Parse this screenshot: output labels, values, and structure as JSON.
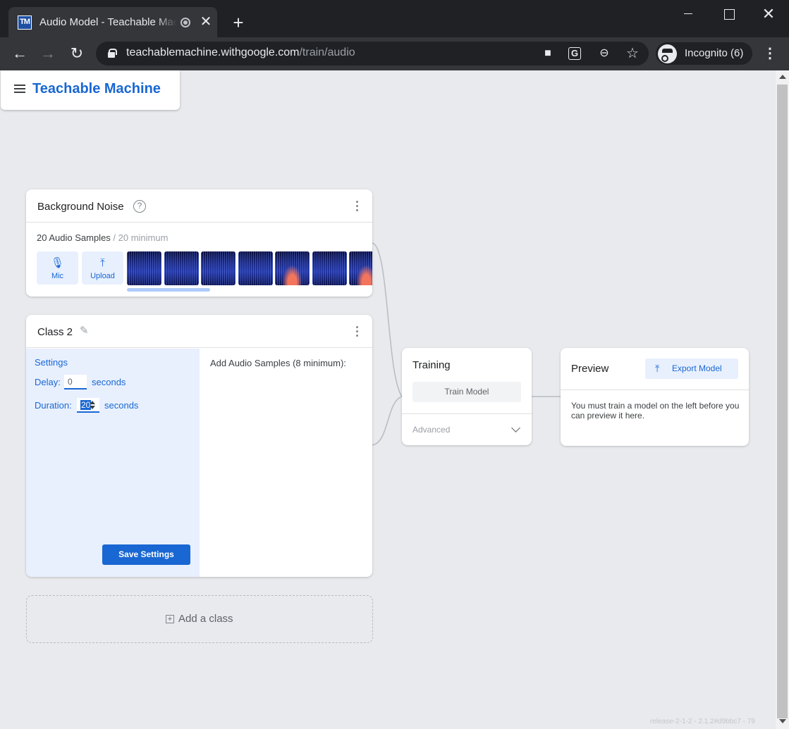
{
  "browser": {
    "tab_title": "Audio Model - Teachable Machine",
    "favicon_text": "TM",
    "close_glyph": "✕",
    "new_tab_glyph": "+",
    "window_close_glyph": "✕",
    "back_glyph": "←",
    "forward_glyph": "→",
    "reload_glyph": "↻",
    "url_host": "teachablemachine.withgoogle.com",
    "url_path": "/train/audio",
    "incognito_label": "Incognito (6)",
    "camera_glyph": "■",
    "translate_glyph": "G",
    "zoom_glyph": "⊖",
    "star_glyph": "☆",
    "menu_glyph": "⋮"
  },
  "app": {
    "brand": "Teachable Machine"
  },
  "class_background": {
    "title": "Background Noise",
    "help_glyph": "?",
    "sample_count": "20 Audio Samples",
    "sample_min": " / 20 minimum",
    "mic_label": "Mic",
    "upload_label": "Upload",
    "mic_glyph": "🎙",
    "upload_glyph": "⤒"
  },
  "class_2": {
    "title": "Class 2",
    "edit_glyph": "✎",
    "settings_title": "Settings",
    "delay_label": "Delay:",
    "delay_value": "0",
    "delay_suffix": "seconds",
    "duration_label": "Duration:",
    "duration_value": "20",
    "duration_suffix": "seconds",
    "save_label": "Save Settings",
    "add_samples_label": "Add Audio Samples (8 minimum):"
  },
  "add_class": {
    "plus_glyph": "+",
    "label": "Add a class"
  },
  "training": {
    "title": "Training",
    "train_button": "Train Model",
    "advanced_label": "Advanced"
  },
  "preview": {
    "title": "Preview",
    "export_glyph": "⤒",
    "export_label": "Export Model",
    "message": "You must train a model on the left before you can preview it here."
  },
  "footer": {
    "version": "release-2-1-2 - 2.1.2#d9bbc7 - 79"
  },
  "colors": {
    "accent": "#1967d2",
    "page_bg": "#e8eaed",
    "settings_bg": "#e8f0fe"
  }
}
